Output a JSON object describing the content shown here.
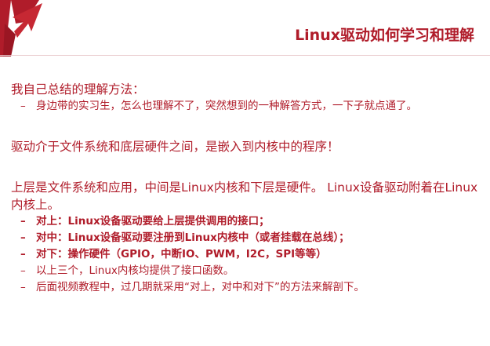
{
  "slide": {
    "title": "Linux驱动如何学习和理解",
    "brand_color": "#b01c2a"
  },
  "section1": {
    "heading": "我自己总结的理解方法：",
    "bullets": [
      "身边带的实习生，怎么也理解不了，突然想到的一种解答方式，一下子就点通了。"
    ]
  },
  "section2": {
    "text": "驱动介于文件系统和底层硬件之间，是嵌入到内核中的程序！"
  },
  "section3": {
    "text": "上层是文件系统和应用，中间是Linux内核和下层是硬件。 Linux设备驱动附着在Linux内核上。",
    "bullets": [
      "对上：Linux设备驱动要给上层提供调用的接口；",
      "对中：Linux设备驱动要注册到Linux内核中（或者挂载在总线）；",
      "对下：操作硬件（GPIO，中断IO、PWM，I2C，SPI等等）",
      "以上三个，Linux内核均提供了接口函数。",
      "后面视频教程中，过几期就采用“对上，对中和对下”的方法来解剖下。"
    ],
    "dash": "–"
  },
  "icons": {
    "logo": "arrow-logo-icon"
  }
}
